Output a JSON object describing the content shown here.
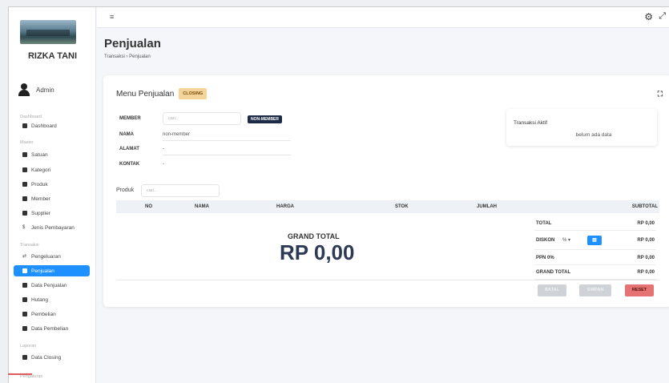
{
  "brand": {
    "name": "RIZKA TANI"
  },
  "user": {
    "name": "Admin"
  },
  "sidebar": {
    "sections": [
      "Dashboard",
      "Master",
      "Transaksi",
      "Laporan",
      "Pengaturan"
    ],
    "items": [
      {
        "label": "Dashboard",
        "icon": "home-icon"
      },
      {
        "label": "Satuan",
        "icon": "folder-icon"
      },
      {
        "label": "Kategori",
        "icon": "folder-open-icon"
      },
      {
        "label": "Produk",
        "icon": "box-icon"
      },
      {
        "label": "Member",
        "icon": "user-icon"
      },
      {
        "label": "Supplier",
        "icon": "truck-icon"
      },
      {
        "label": "Jenis Pembayaran",
        "icon": "dollar-icon"
      },
      {
        "label": "Pengeluaran",
        "icon": "exchange-icon"
      },
      {
        "label": "Penjualan",
        "icon": "cart-icon",
        "active": true
      },
      {
        "label": "Data Penjualan",
        "icon": "chart-icon"
      },
      {
        "label": "Hutang",
        "icon": "card-icon"
      },
      {
        "label": "Pembelian",
        "icon": "truck-icon"
      },
      {
        "label": "Data Pembelian",
        "icon": "clipboard-icon"
      },
      {
        "label": "Data Closing",
        "icon": "file-icon"
      }
    ]
  },
  "header": {
    "menu_icon": "≡",
    "settings_icon": "⚙",
    "expand_icon": "⤢"
  },
  "page": {
    "title": "Penjualan",
    "breadcrumb": "Transaksi  ›  Penjualan"
  },
  "card": {
    "title": "Menu Penjualan",
    "badge": "CLOSING",
    "member_label": "MEMBER",
    "member_placeholder": "cari..",
    "nonmember_btn": "NON-MEMBER",
    "nama_label": "NAMA",
    "nama_value": "non-member",
    "alamat_label": "ALAMAT",
    "alamat_value": "-",
    "kontak_label": "KONTAK",
    "kontak_value": "-",
    "transaksi_title": "Transaksi Aktif",
    "transaksi_empty": "belum ada data",
    "produk_label": "Produk",
    "produk_placeholder": "cari.."
  },
  "table": {
    "headers": [
      "NO",
      "NAMA",
      "HARGA",
      "STOK",
      "JUMLAH",
      "SUBTOTAL"
    ]
  },
  "grand": {
    "label": "GRAND TOTAL",
    "value": "RP 0,00"
  },
  "summary": {
    "total_label": "TOTAL",
    "total_value": "RP 0,00",
    "diskon_label": "DISKON",
    "diskon_unit": "%  ▾",
    "diskon_value": "RP 0,00",
    "ppn_label": "PPN 0%",
    "ppn_value": "RP 0,00",
    "grand_label": "GRAND TOTAL",
    "grand_value": "RP 0,00"
  },
  "buttons": {
    "batal": "BATAL",
    "simpan": "SIMPAN",
    "reset": "RESET"
  },
  "colors": {
    "accent": "#1e90ff",
    "badge": "#f5d49c",
    "reset": "#e57373",
    "nonmember": "#1d2b47"
  }
}
